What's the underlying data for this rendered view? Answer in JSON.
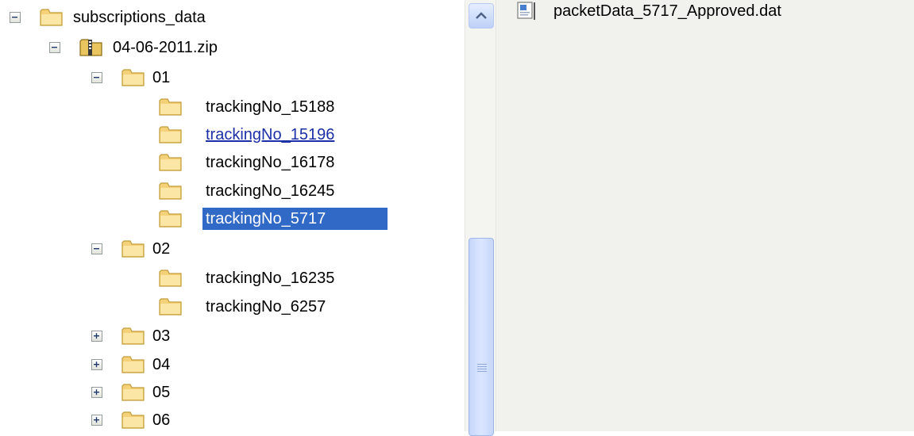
{
  "tree": {
    "root": {
      "label": "subscriptions_data",
      "icon": "folder-icon",
      "state": "expanded"
    },
    "zip": {
      "label": "04-06-2011.zip",
      "icon": "zip-folder-icon",
      "state": "expanded"
    },
    "folders": [
      {
        "label": "01",
        "state": "expanded",
        "children": [
          "trackingNo_15188",
          "trackingNo_15196",
          "trackingNo_16178",
          "trackingNo_16245",
          "trackingNo_5717"
        ]
      },
      {
        "label": "02",
        "state": "expanded",
        "children": [
          "trackingNo_16235",
          "trackingNo_6257"
        ]
      },
      {
        "label": "03",
        "state": "collapsed",
        "children": []
      },
      {
        "label": "04",
        "state": "collapsed",
        "children": []
      },
      {
        "label": "05",
        "state": "collapsed",
        "children": []
      },
      {
        "label": "06",
        "state": "collapsed",
        "children": []
      }
    ],
    "hovered": "trackingNo_15196",
    "selected": "trackingNo_5717"
  },
  "file_list": {
    "items": [
      {
        "name": "packetData_5717_Approved.dat",
        "icon": "data-file-icon"
      }
    ]
  },
  "colors": {
    "selection": "#3169c6",
    "hover_link": "#1c2fa6",
    "folder_fill": "#f5d27a",
    "pane_background": "#f1f1ed"
  }
}
